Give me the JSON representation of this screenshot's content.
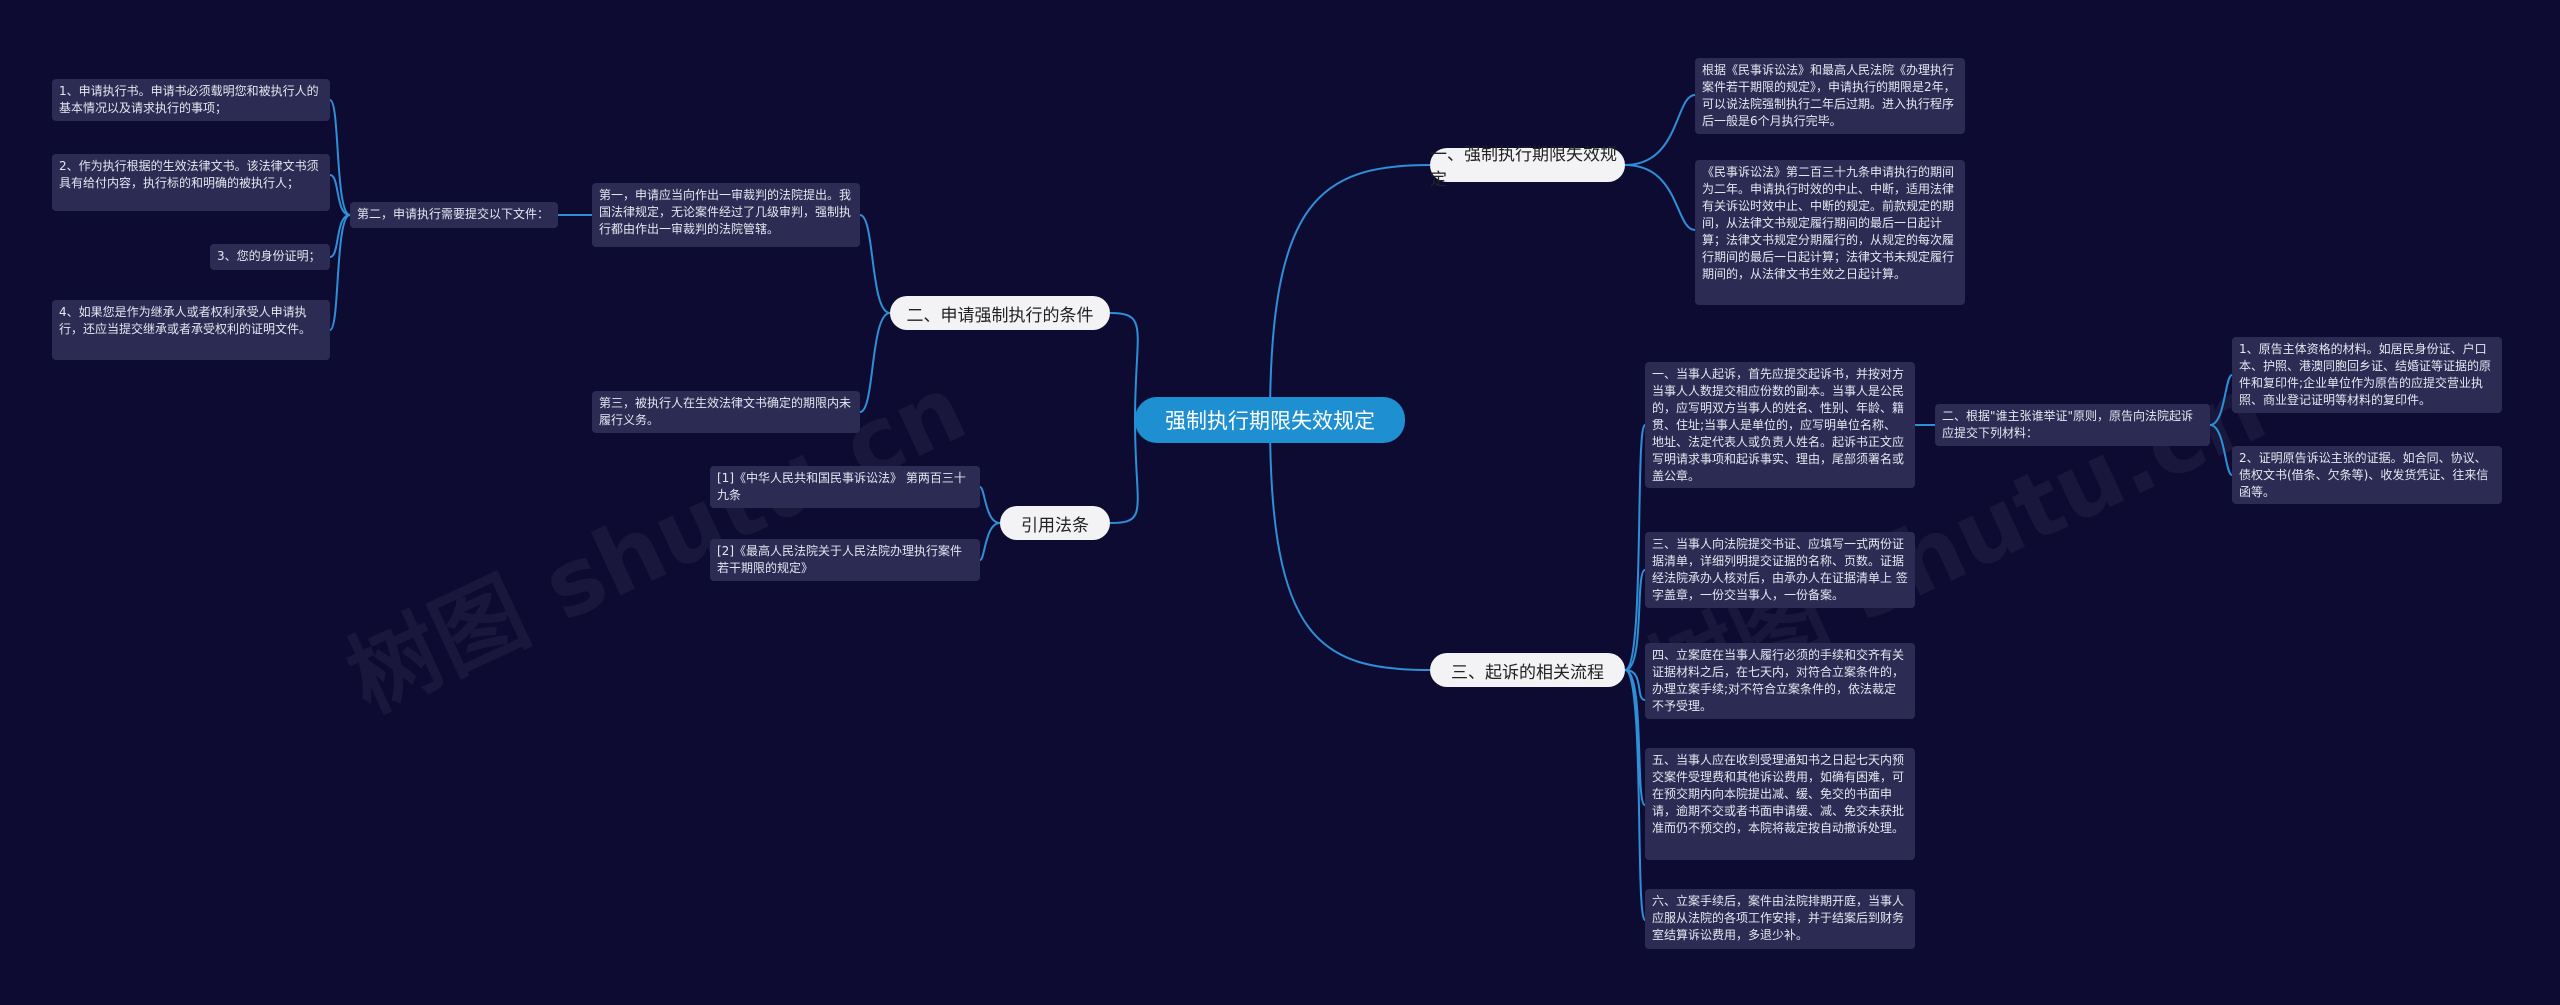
{
  "watermark": "树图 shutu.cn",
  "root": {
    "label": "强制执行期限失效规定"
  },
  "branch1": {
    "label": "一、强制执行期限失效规定",
    "items": [
      "根据《民事诉讼法》和最高人民法院《办理执行案件若干期限的规定》，申请执行的期限是2年，可以说法院强制执行二年后过期。进入执行程序后一般是6个月执行完毕。",
      "《民事诉讼法》第二百三十九条申请执行的期间为二年。申请执行时效的中止、中断，适用法律有关诉讼时效中止、中断的规定。前款规定的期间，从法律文书规定履行期间的最后一日起计算；法律文书规定分期履行的，从规定的每次履行期间的最后一日起计算；法律文书未规定履行期间的，从法律文书生效之日起计算。"
    ]
  },
  "branch2": {
    "label": "二、申请强制执行的条件",
    "first": "第一，申请应当向作出一审裁判的法院提出。我国法律规定，无论案件经过了几级审判，强制执行都由作出一审裁判的法院管辖。",
    "second": "第二，申请执行需要提交以下文件：",
    "second_items": [
      "1、申请执行书。申请书必须载明您和被执行人的基本情况以及请求执行的事项；",
      "2、作为执行根据的生效法律文书。该法律文书须具有给付内容，执行标的和明确的被执行人；",
      "3、您的身份证明；",
      "4、如果您是作为继承人或者权利承受人申请执行，还应当提交继承或者承受权利的证明文件。"
    ],
    "third": "第三，被执行人在生效法律文书确定的期限内未履行义务。"
  },
  "branch3": {
    "label": "三、起诉的相关流程",
    "items": [
      "一、当事人起诉，首先应提交起诉书，并按对方当事人人数提交相应份数的副本。当事人是公民的，应写明双方当事人的姓名、性别、年龄、籍贯、住址;当事人是单位的，应写明单位名称、地址、法定代表人或负责人姓名。起诉书正文应写明请求事项和起诉事实、理由，尾部须署名或盖公章。",
      "三、当事人向法院提交书证、应填写一式两份证据清单，详细列明提交证据的名称、页数。证据经法院承办人核对后，由承办人在证据清单上 签字盖章，一份交当事人，一份备案。",
      "四、立案庭在当事人履行必须的手续和交齐有关证据材料之后，在七天内，对符合立案条件的，办理立案手续;对不符合立案条件的，依法裁定不予受理。",
      "五、当事人应在收到受理通知书之日起七天内预交案件受理费和其他诉讼费用，如确有困难，可在预交期内向本院提出减、缓、免交的书面申请，逾期不交或者书面申请缓、减、免交未获批准而仍不预交的，本院将裁定按自动撤诉处理。",
      "六、立案手续后，案件由法院排期开庭，当事人应服从法院的各项工作安排，并于结案后到财务室结算诉讼费用，多退少补。"
    ],
    "sub_label": "二、根据\"谁主张谁举证\"原则，原告向法院起诉应提交下列材料：",
    "sub_items": [
      "1、原告主体资格的材料。如居民身份证、户口本、护照、港澳同胞回乡证、结婚证等证据的原件和复印件;企业单位作为原告的应提交营业执照、商业登记证明等材料的复印件。",
      "2、证明原告诉讼主张的证据。如合同、协议、债权文书(借条、欠条等)、收发货凭证、往来信函等。"
    ]
  },
  "branch4": {
    "label": "引用法条",
    "items": [
      "[1]《中华人民共和国民事诉讼法》 第两百三十九条",
      "[2]《最高人民法院关于人民法院办理执行案件若干期限的规定》"
    ]
  },
  "colors": {
    "background": "#0e0b33",
    "root": "#1e8fd0",
    "link": "#2e8fd6",
    "leaf": "#2b2b53",
    "branch": "#f3f3f6"
  }
}
